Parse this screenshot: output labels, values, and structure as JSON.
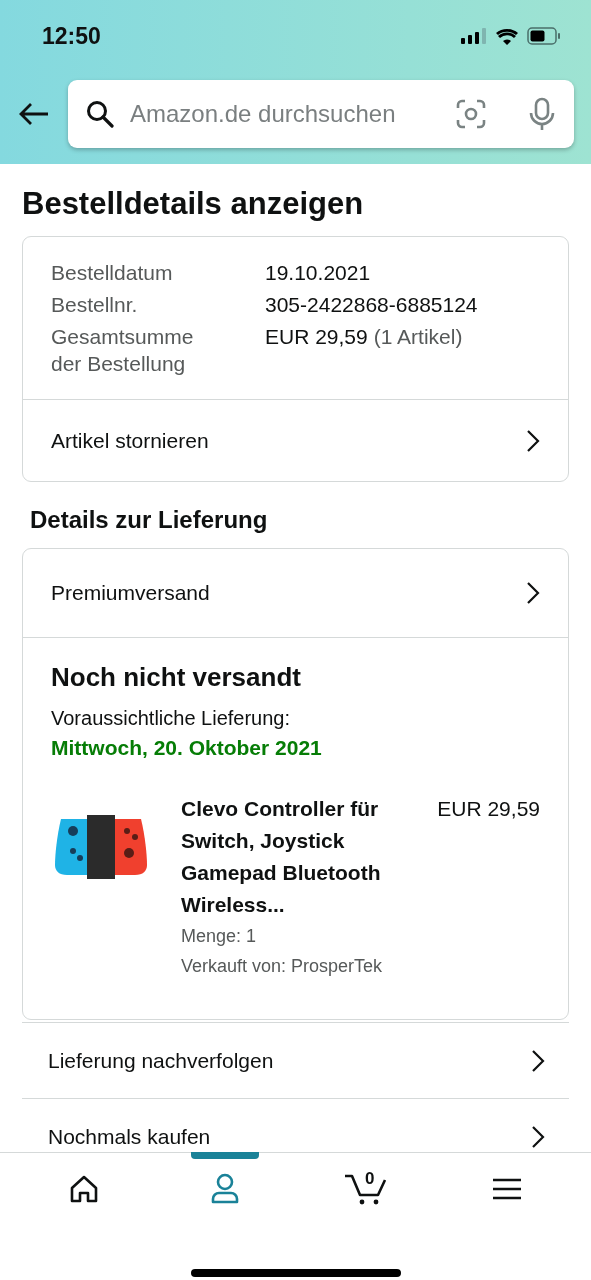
{
  "status_bar": {
    "time": "12:50"
  },
  "search": {
    "placeholder": "Amazon.de durchsuchen"
  },
  "page_title": "Bestelldetails anzeigen",
  "order_info": {
    "rows": [
      {
        "label": "Bestelldatum",
        "value": "19.10.2021"
      },
      {
        "label": "Bestellnr.",
        "value": "305-2422868-6885124"
      },
      {
        "label": "Gesamtsumme der Bestellung",
        "value": "EUR 29,59",
        "note": "(1 Artikel)"
      }
    ],
    "action": "Artikel stornieren"
  },
  "delivery_heading": "Details zur Lieferung",
  "shipping_method": "Premiumversand",
  "shipment": {
    "status": "Noch nicht versandt",
    "eta_label": "Voraussichtliche Lieferung:",
    "eta_date": "Mittwoch, 20. Oktober 2021",
    "item": {
      "kind": "picture",
      "title": "Clevo Controller für Switch, Joystick Gamepad Bluetooth Wireless...",
      "price": "EUR 29,59",
      "quantity": "Menge: 1",
      "seller": "Verkauft von: ProsperTek"
    }
  },
  "links": [
    "Lieferung nachverfolgen",
    "Nochmals kaufen"
  ],
  "nav": [
    {
      "kind": "home",
      "selected": false
    },
    {
      "kind": "account",
      "selected": true
    },
    {
      "kind": "cart",
      "count": "0",
      "selected": false
    },
    {
      "kind": "menu",
      "selected": false
    }
  ]
}
